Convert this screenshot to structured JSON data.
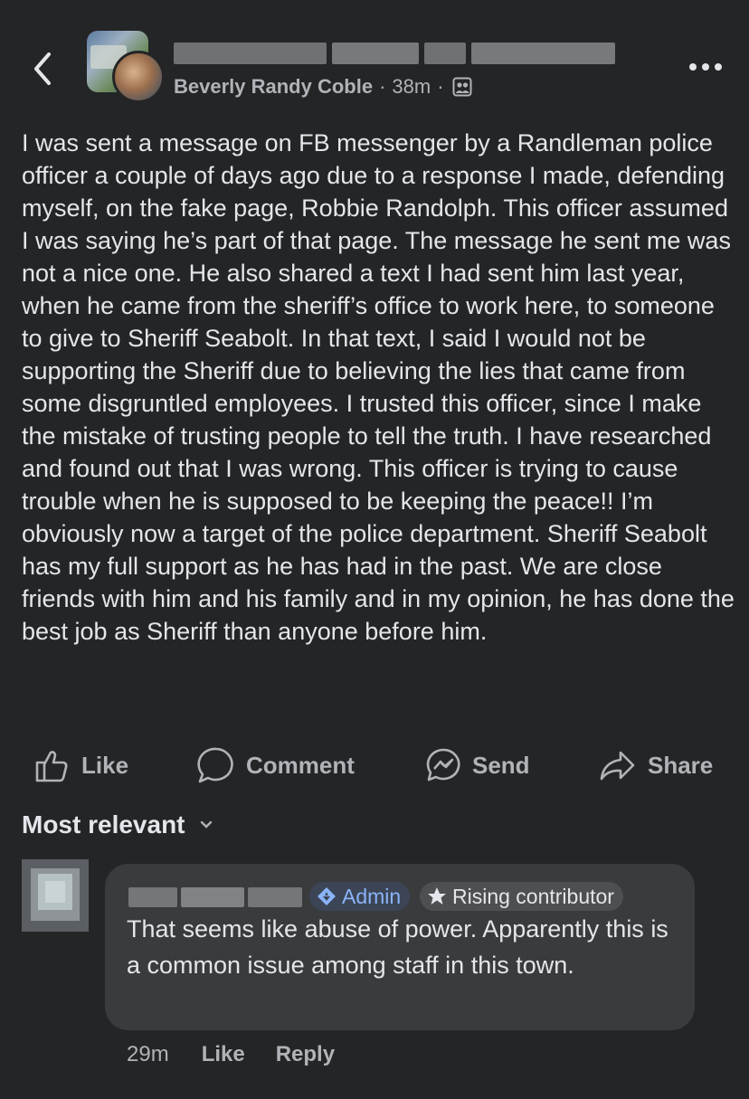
{
  "header": {
    "author": "Beverly Randy Coble",
    "separator": "·",
    "time": "38m",
    "privacy_icon": "group-members-icon",
    "back_icon": "chevron-left-icon",
    "more_icon": "more-horizontal-icon"
  },
  "post": {
    "text": "I was sent a message on FB messenger by a Randleman police officer a couple of days ago due to a response I made, defending myself, on the fake page, Robbie Randolph.  This officer assumed I was saying he’s part of that page.  The message he sent me was not a nice one.  He also shared  a text I had sent him last year,  when he came from the sheriff’s office to work here, to someone to give to Sheriff Seabolt.  In that text, I said I would not be supporting the Sheriff due to believing the lies that came from some disgruntled employees.  I trusted this officer, since I make the mistake of trusting people to tell the truth.  I have researched and found out that I was wrong.  This officer is trying to cause trouble when he is supposed to be keeping the peace!! I’m obviously now a target of the police department.  Sheriff Seabolt has my full support as he has had in the past.  We are close friends with him and his family and in my opinion, he has done the best job as Sheriff than anyone before him."
  },
  "actions": {
    "like": "Like",
    "comment": "Comment",
    "send": "Send",
    "share": "Share"
  },
  "comments": {
    "sort_label": "Most relevant",
    "items": [
      {
        "badge_admin": "Admin",
        "badge_rising": "Rising contributor",
        "text": "That seems like abuse of power.  Apparently this is a common issue among staff in this town.",
        "time": "29m",
        "like": "Like",
        "reply": "Reply"
      }
    ]
  },
  "colors": {
    "background": "#242526",
    "bubble": "#3a3b3c",
    "text": "#e4e6eb",
    "secondary": "#b0b3b8",
    "admin_accent": "#8ab4f8"
  }
}
